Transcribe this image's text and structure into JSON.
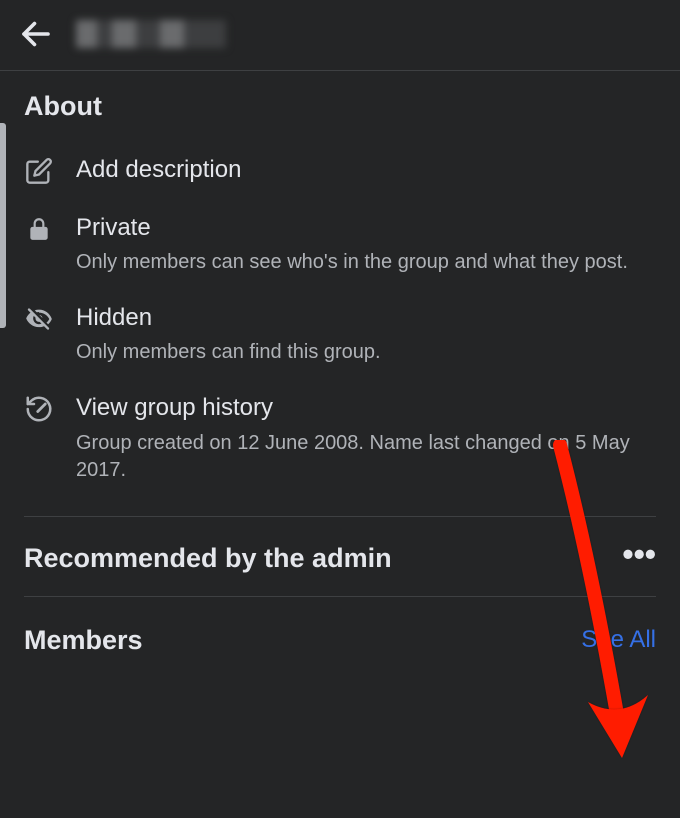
{
  "about": {
    "title": "About",
    "add_description": "Add description",
    "privacy": {
      "label": "Private",
      "desc": "Only members can see who's in the group and what they post."
    },
    "visibility": {
      "label": "Hidden",
      "desc": "Only members can find this group."
    },
    "history": {
      "label": "View group history",
      "desc": "Group created on 12 June 2008. Name last changed on 5 May 2017."
    }
  },
  "recommended": {
    "title": "Recommended by the admin"
  },
  "members": {
    "title": "Members",
    "see_all": "See All"
  }
}
